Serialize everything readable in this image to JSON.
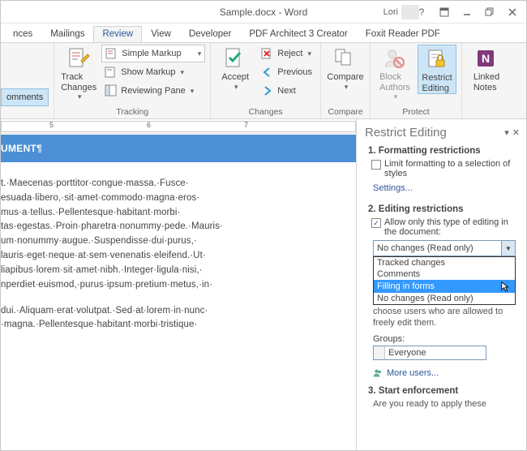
{
  "title": "Sample.docx - Word",
  "user": "Lori",
  "tabs": [
    "nces",
    "Mailings",
    "Review",
    "View",
    "Developer",
    "PDF Architect 3 Creator",
    "Foxit Reader PDF"
  ],
  "active_tab": "Review",
  "ribbon": {
    "comments_btn": "omments",
    "tracking": {
      "label": "Tracking",
      "track_changes": "Track\nChanges",
      "markup": "Simple Markup",
      "show_markup": "Show Markup",
      "reviewing_pane": "Reviewing Pane"
    },
    "changes": {
      "label": "Changes",
      "accept": "Accept",
      "reject": "Reject",
      "previous": "Previous",
      "next": "Next"
    },
    "compare": {
      "label": "Compare",
      "compare": "Compare"
    },
    "protect": {
      "label": "Protect",
      "block_authors": "Block\nAuthors",
      "restrict_editing": "Restrict\nEditing"
    },
    "onenote": {
      "linked_notes": "Linked\nNotes"
    }
  },
  "ruler": {
    "marks": [
      "5",
      "6",
      "7"
    ]
  },
  "document": {
    "heading": "UMENT¶",
    "para1": "t.·Maecenas·porttitor·congue·massa.·Fusce· esuada·libero,·sit·amet·commodo·magna·eros· mus·a·tellus.·Pellentesque·habitant·morbi· tas·egestas.·Proin·pharetra·nonummy·pede.·Mauris· um·nonummy·augue.·Suspendisse·dui·purus,· lauris·eget·neque·at·sem·venenatis·eleifend.·Ut· liapibus·lorem·sit·amet·nibh.·Integer·ligula·nisi,· nperdiet·euismod,·purus·ipsum·pretium·metus,·in·",
    "para2": "dui.·Aliquam·erat·volutpat.·Sed·at·lorem·in·nunc· ·magna.·Pellentesque·habitant·morbi·tristique·"
  },
  "pane": {
    "title": "Restrict Editing",
    "s1": {
      "h": "1. Formatting restrictions",
      "cb": "Limit formatting to a selection of styles",
      "settings": "Settings..."
    },
    "s2": {
      "h": "2. Editing restrictions",
      "cb": "Allow only this type of editing in the document:",
      "selected": "No changes (Read only)",
      "options": [
        "Tracked changes",
        "Comments",
        "Filling in forms",
        "No changes (Read only)"
      ],
      "note": "choose users who are allowed to freely edit them.",
      "groups_label": "Groups:",
      "group": "Everyone",
      "more": "More users..."
    },
    "s3": {
      "h": "3. Start enforcement",
      "q": "Are you ready to apply these"
    }
  }
}
